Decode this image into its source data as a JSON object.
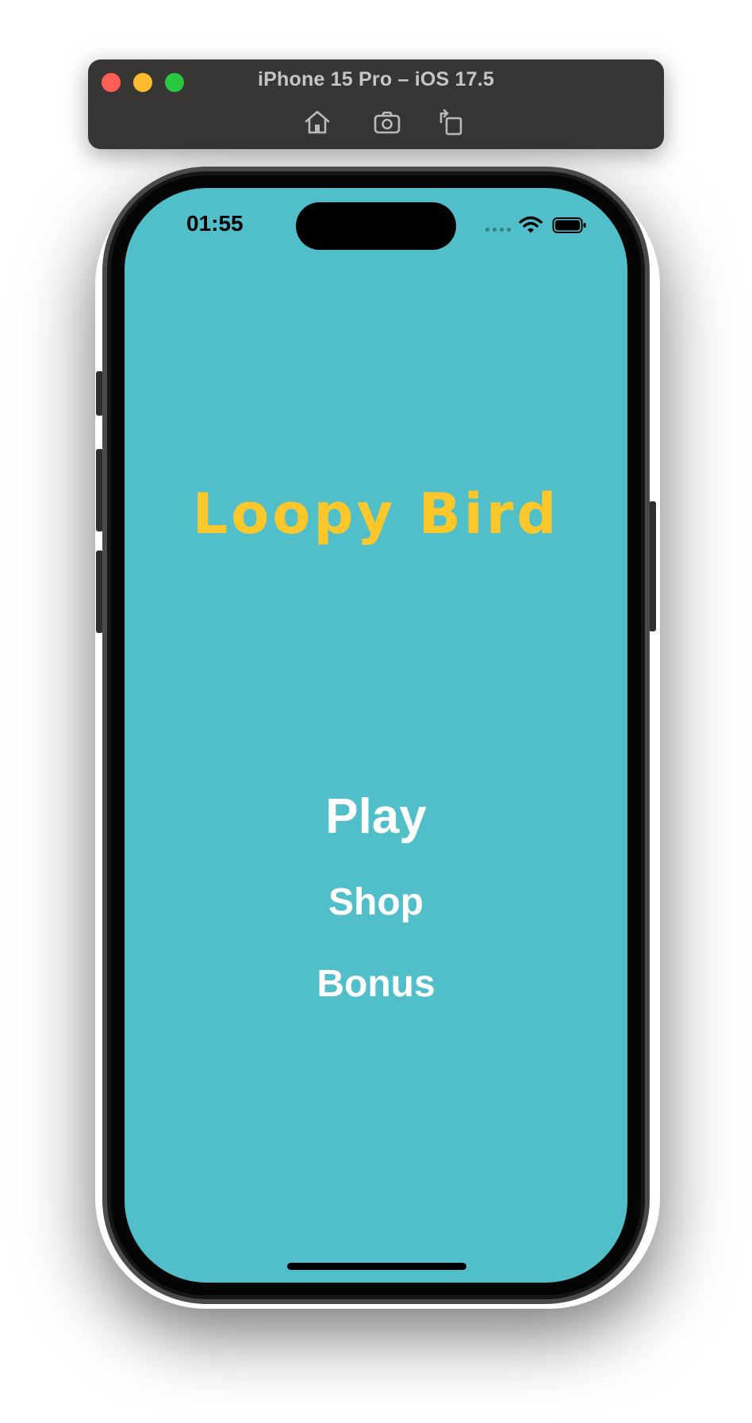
{
  "window": {
    "title": "iPhone 15 Pro – iOS 17.5",
    "toolbar_icons": [
      "home-icon",
      "screenshot-icon",
      "rotate-icon"
    ],
    "traffic_light_colors": [
      "#fe5f57",
      "#febc2e",
      "#28c840"
    ]
  },
  "status_bar": {
    "time": "01:55",
    "icons": [
      "cellular-dots-icon",
      "wifi-icon",
      "battery-icon"
    ]
  },
  "game": {
    "title": "Loopy Bird",
    "title_color": "#fcc72b",
    "background_color": "#51bfc9",
    "menu": {
      "play": "Play",
      "shop": "Shop",
      "bonus": "Bonus"
    }
  }
}
